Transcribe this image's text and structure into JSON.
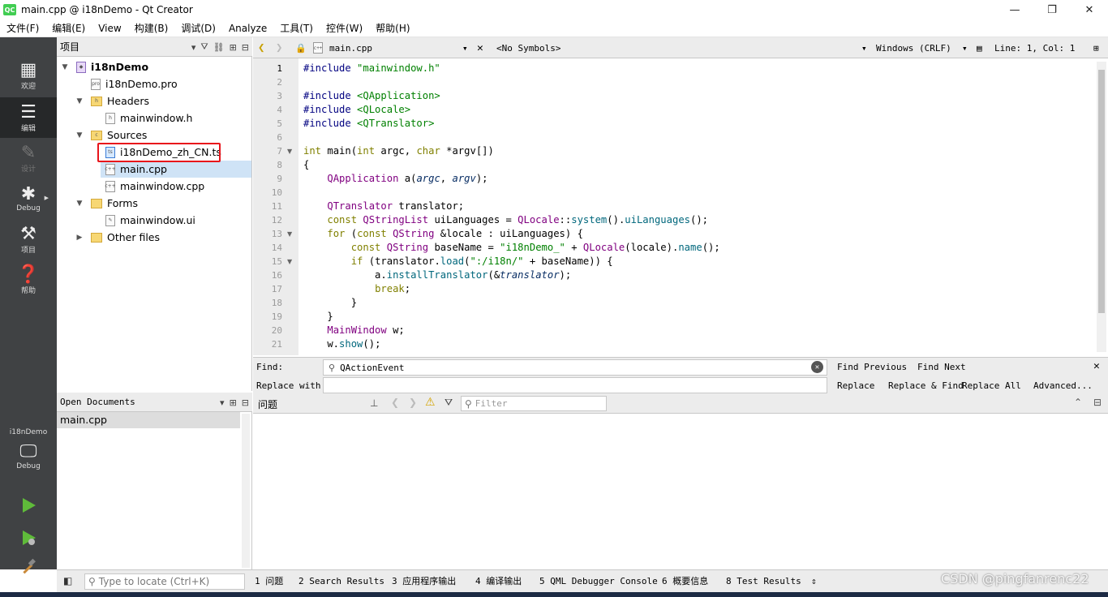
{
  "window": {
    "title": "main.cpp @ i18nDemo - Qt Creator",
    "logo": "QC",
    "minimize": "—",
    "restore": "❐",
    "close": "✕"
  },
  "menu": [
    "文件(F)",
    "编辑(E)",
    "View",
    "构建(B)",
    "调试(D)",
    "Analyze",
    "工具(T)",
    "控件(W)",
    "帮助(H)"
  ],
  "modes": {
    "welcome": "欢迎",
    "edit": "编辑",
    "design": "设计",
    "debug": "Debug",
    "projects": "项目",
    "help": "帮助"
  },
  "kit": {
    "name": "i18nDemo",
    "build_mode": "Debug"
  },
  "projects_panel": {
    "title": "项目",
    "tree": [
      {
        "label": "i18nDemo",
        "bold": true
      },
      {
        "label": "i18nDemo.pro"
      },
      {
        "label": "Headers"
      },
      {
        "label": "mainwindow.h"
      },
      {
        "label": "Sources"
      },
      {
        "label": "i18nDemo_zh_CN.ts"
      },
      {
        "label": "main.cpp"
      },
      {
        "label": "mainwindow.cpp"
      },
      {
        "label": "Forms"
      },
      {
        "label": "mainwindow.ui"
      },
      {
        "label": "Other files"
      }
    ]
  },
  "open_documents": {
    "title": "Open Documents",
    "items": [
      "main.cpp"
    ]
  },
  "editor_toolbar": {
    "file": "main.cpp",
    "symbols": "<No Symbols>",
    "line_endings": "Windows (CRLF)",
    "position": "Line: 1, Col: 1"
  },
  "code_lines": [
    {
      "n": "1",
      "t": "#include \"mainwindow.h\""
    },
    {
      "n": "2",
      "t": ""
    },
    {
      "n": "3",
      "t": "#include <QApplication>"
    },
    {
      "n": "4",
      "t": "#include <QLocale>"
    },
    {
      "n": "5",
      "t": "#include <QTranslator>"
    },
    {
      "n": "6",
      "t": ""
    },
    {
      "n": "7",
      "t": "int main(int argc, char *argv[])"
    },
    {
      "n": "8",
      "t": "{"
    },
    {
      "n": "9",
      "t": "    QApplication a(argc, argv);"
    },
    {
      "n": "10",
      "t": ""
    },
    {
      "n": "11",
      "t": "    QTranslator translator;"
    },
    {
      "n": "12",
      "t": "    const QStringList uiLanguages = QLocale::system().uiLanguages();"
    },
    {
      "n": "13",
      "t": "    for (const QString &locale : uiLanguages) {"
    },
    {
      "n": "14",
      "t": "        const QString baseName = \"i18nDemo_\" + QLocale(locale).name();"
    },
    {
      "n": "15",
      "t": "        if (translator.load(\":/i18n/\" + baseName)) {"
    },
    {
      "n": "16",
      "t": "            a.installTranslator(&translator);"
    },
    {
      "n": "17",
      "t": "            break;"
    },
    {
      "n": "18",
      "t": "        }"
    },
    {
      "n": "19",
      "t": "    }"
    },
    {
      "n": "20",
      "t": "    MainWindow w;"
    },
    {
      "n": "21",
      "t": "    w.show();"
    }
  ],
  "find": {
    "find_label": "Find:",
    "replace_label": "Replace with:",
    "find_value": "QActionEvent",
    "replace_value": "",
    "find_previous": "Find Previous",
    "find_next": "Find Next",
    "replace": "Replace",
    "replace_find": "Replace & Find",
    "replace_all": "Replace All",
    "advanced": "Advanced..."
  },
  "issues": {
    "title": "问题",
    "filter_placeholder": "Filter"
  },
  "status": {
    "locator_placeholder": "Type to locate (Ctrl+K)",
    "tabs": [
      "1 问题",
      "2 Search Results",
      "3 应用程序输出",
      "4 编译输出",
      "5 QML Debugger Console",
      "6 概要信息",
      "8 Test Results"
    ]
  },
  "watermark": "CSDN @pingfanrenc22"
}
